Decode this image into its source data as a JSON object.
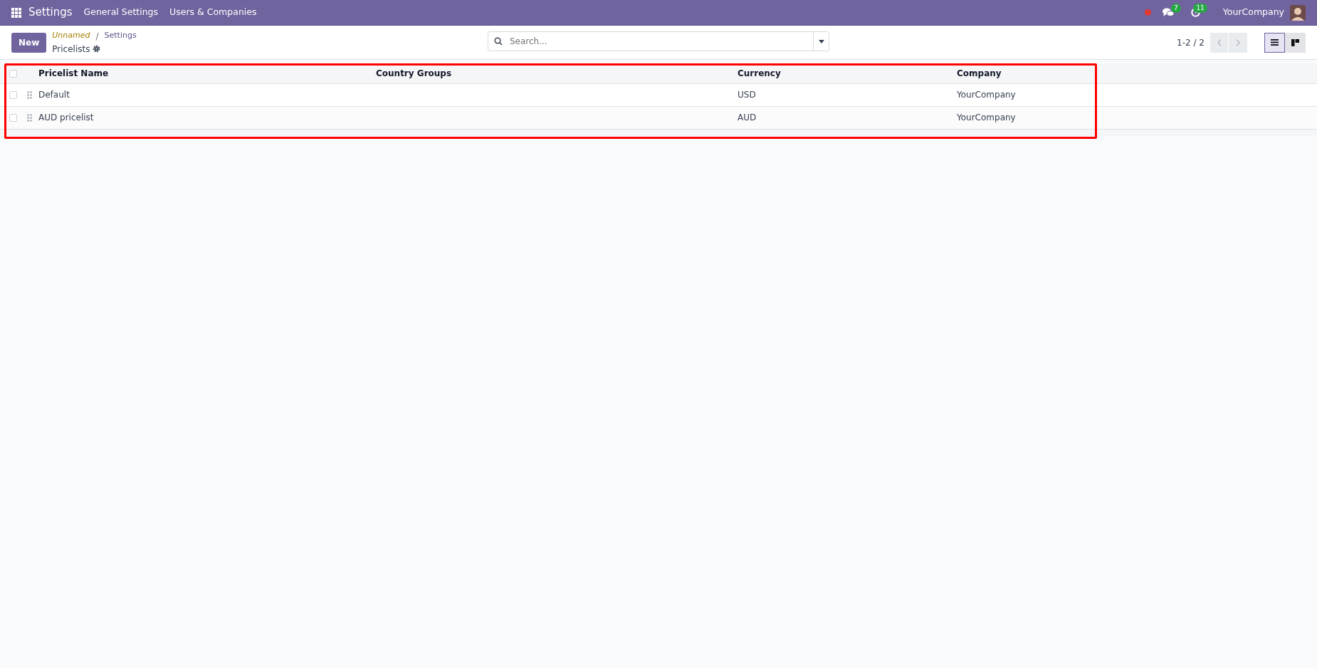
{
  "navbar": {
    "app_name": "Settings",
    "menu": [
      "General Settings",
      "Users & Companies"
    ],
    "messages_count": "7",
    "activities_count": "11",
    "company": "YourCompany"
  },
  "control_panel": {
    "new_button": "New",
    "breadcrumb": [
      {
        "label": "Unnamed",
        "kind": "unsaved"
      },
      {
        "label": "Settings",
        "kind": "link"
      }
    ],
    "breadcrumb_separator": "/",
    "current": "Pricelists",
    "search": {
      "placeholder": "Search..."
    },
    "pager": "1-2 / 2",
    "views": [
      {
        "kind": "list",
        "selected": true
      },
      {
        "kind": "kanban",
        "selected": false
      }
    ]
  },
  "table": {
    "select_all_checked": false,
    "columns": [
      "Pricelist Name",
      "Country Groups",
      "Currency",
      "Company"
    ],
    "rows": [
      {
        "checked": false,
        "cells": [
          "Default",
          "",
          "USD",
          "YourCompany"
        ]
      },
      {
        "checked": false,
        "cells": [
          "AUD pricelist",
          "",
          "AUD",
          "YourCompany"
        ]
      }
    ]
  },
  "highlight_frame": true
}
